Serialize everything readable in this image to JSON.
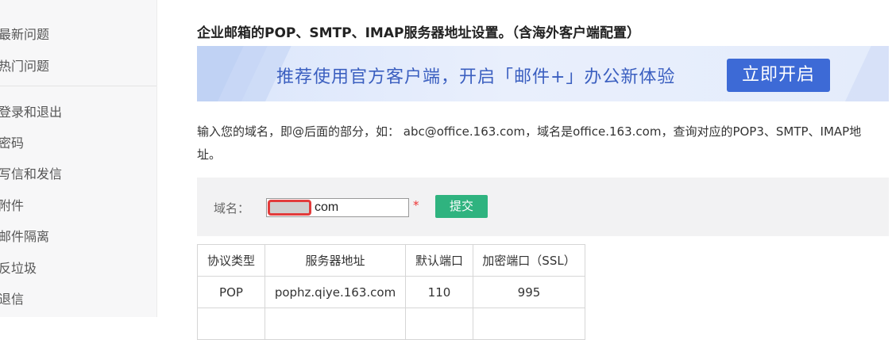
{
  "sidebar": {
    "items": [
      {
        "label": "最新问题"
      },
      {
        "label": "热门问题"
      },
      {
        "label": "登录和退出"
      },
      {
        "label": "密码"
      },
      {
        "label": "写信和发信"
      },
      {
        "label": "附件"
      },
      {
        "label": "邮件隔离"
      },
      {
        "label": "反垃圾"
      },
      {
        "label": "退信"
      }
    ]
  },
  "main": {
    "heading": "企业邮箱的POP、SMTP、IMAP服务器地址设置。（含海外客户端配置）",
    "banner": {
      "text": "推荐使用官方客户端，开启「邮件+」办公新体验",
      "button_label": "立即开启"
    },
    "intro": "输入您的域名，即@后面的部分，如： abc@office.163.com，域名是office.163.com，查询对应的POP3、SMTP、IMAP地址。",
    "form": {
      "label": "域名：",
      "value": "com",
      "required_mark": "*",
      "submit_label": "提交"
    },
    "table": {
      "headers": [
        "协议类型",
        "服务器地址",
        "默认端口",
        "加密端口（SSL）"
      ],
      "rows": [
        [
          "POP",
          "pophz.qiye.163.com",
          "110",
          "995"
        ]
      ]
    }
  },
  "colors": {
    "accent_blue": "#3d6ad6",
    "submit_green": "#2fb37f",
    "required_red": "#e33333"
  }
}
